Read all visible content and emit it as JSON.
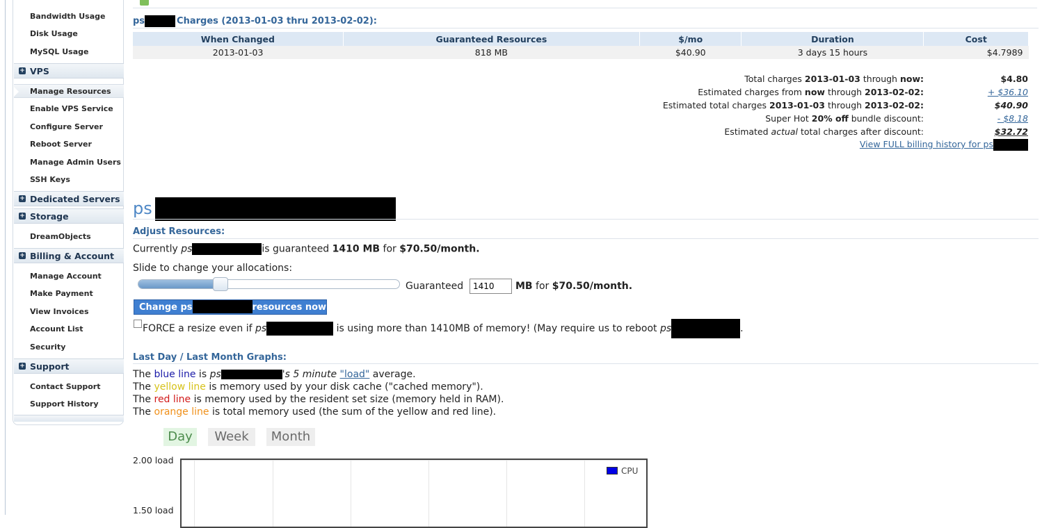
{
  "sidebar": {
    "items_top": [
      "Bandwidth Usage",
      "Disk Usage",
      "MySQL Usage"
    ],
    "sections": [
      {
        "label": "VPS",
        "items": [
          "Manage Resources",
          "Enable VPS Service",
          "Configure Server",
          "Reboot Server",
          "Manage Admin Users",
          "SSH Keys"
        ]
      },
      {
        "label": "Dedicated Servers",
        "items": []
      },
      {
        "label": "Storage",
        "items": [
          "DreamObjects"
        ]
      },
      {
        "label": "Billing & Account",
        "items": [
          "Manage Account",
          "Make Payment",
          "View Invoices",
          "Account List",
          "Security"
        ]
      },
      {
        "label": "Support",
        "items": [
          "Contact Support",
          "Support History"
        ]
      }
    ],
    "active_item": "Manage Resources"
  },
  "charges": {
    "prefix": "ps",
    "title_suffix": "Charges (2013-01-03 thru 2013-02-02):",
    "headers": [
      "When Changed",
      "Guaranteed Resources",
      "$/mo",
      "Duration",
      "Cost"
    ],
    "rows": [
      [
        "2013-01-03",
        "818 MB",
        "$40.90",
        "3 days 15 hours",
        "$4.7989"
      ]
    ],
    "summary": {
      "total_label_1": "Total charges ",
      "total_date": "2013-01-03",
      "total_label_2": " through ",
      "total_now": "now",
      "total_value": "$4.80",
      "est_label_1": "Estimated charges from ",
      "est_now": "now",
      "est_label_2": " through ",
      "est_date": "2013-02-02",
      "est_value": "+ $36.10",
      "esttot_label_1": "Estimated total charges ",
      "esttot_date_1": "2013-01-03",
      "esttot_label_2": " through ",
      "esttot_date_2": "2013-02-02",
      "esttot_value": "$40.90",
      "disc_label_1": "Super Hot ",
      "disc_pct": "20% off",
      "disc_label_2": " bundle discount:",
      "disc_value": "- $8.18",
      "actual_label_1": "Estimated ",
      "actual_word": "actual",
      "actual_label_2": " total charges after discount:",
      "actual_value": "$32.72",
      "history_link": "View FULL billing history for ps"
    }
  },
  "server": {
    "name_prefix": "ps",
    "adjust_title": "Adjust Resources:",
    "currently_1": "Currently ",
    "currently_ps": "ps",
    "currently_2": "is guaranteed ",
    "currently_mb": "1410 MB",
    "currently_3": " for ",
    "currently_price": "$70.50/month.",
    "slide_label": "Slide to change your allocations:",
    "slider_fraction": 0.3,
    "guaranteed_label": "Guaranteed",
    "guaranteed_value": "1410",
    "mb_for": "MB",
    "for_word": " for ",
    "price": "$70.50/month.",
    "change_btn_1": "Change ps",
    "change_btn_2": "resources now!",
    "force_1": "FORCE a resize even if ",
    "force_ps": "ps",
    "force_2": "is using more than 1410MB of memory! (May require us to reboot ",
    "force_ps2": "ps",
    "force_end": "."
  },
  "graphs": {
    "title": "Last Day / Last Month Graphs:",
    "line1_a": "The ",
    "line1_color": "blue line",
    "line1_b": " is ",
    "line1_ps": "ps",
    "line1_c": "'s 5 minute ",
    "line1_link": "\"load\"",
    "line1_d": " average.",
    "line2_a": "The ",
    "line2_color": "yellow line",
    "line2_b": " is memory used by your disk cache (\"cached memory\").",
    "line3_a": "The ",
    "line3_color": "red line",
    "line3_b": " is memory used by the resident set size (memory held in RAM).",
    "line4_a": "The ",
    "line4_color": "orange line",
    "line4_b": " is total memory used (the sum of the yellow and red line).",
    "tabs": [
      "Day",
      "Week",
      "Month"
    ],
    "active_tab": "Day",
    "y_ticks": [
      "2.00 load",
      "1.50 load"
    ],
    "legend": "CPU",
    "colors": {
      "blue": "#1a1aa8",
      "yellow": "#d6c21a",
      "red": "#d21a1a",
      "orange": "#f0901a",
      "cpu": "#0000e6"
    }
  }
}
